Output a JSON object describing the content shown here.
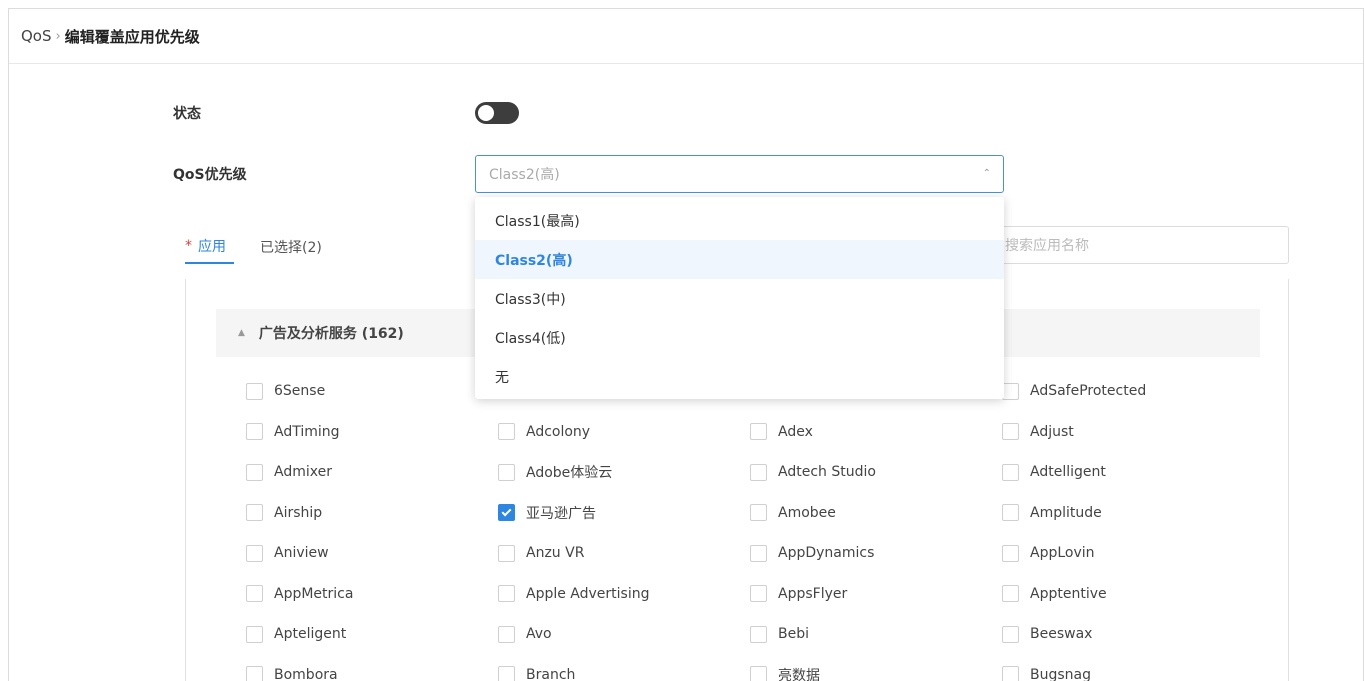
{
  "breadcrumb": {
    "root": "QoS",
    "separator": "›",
    "current": "编辑覆盖应用优先级"
  },
  "form": {
    "status_label": "状态",
    "status_enabled": false,
    "qos_label": "QoS优先级",
    "qos_value": "Class2(高)"
  },
  "dropdown": {
    "options": [
      "Class1(最高)",
      "Class2(高)",
      "Class3(中)",
      "Class4(低)",
      "无"
    ],
    "selected_index": 1
  },
  "tabs": {
    "required_mark": "*",
    "apps_label": "应用",
    "selected_label": "已选择(2)"
  },
  "search": {
    "placeholder": "搜索应用名称"
  },
  "category": {
    "name": "广告及分析服务 (162)"
  },
  "apps": [
    [
      {
        "name": "6Sense",
        "checked": false
      },
      {
        "name": "",
        "checked": false
      },
      {
        "name": "",
        "checked": false
      },
      {
        "name": "AdSafeProtected",
        "checked": false
      }
    ],
    [
      {
        "name": "AdTiming",
        "checked": false
      },
      {
        "name": "Adcolony",
        "checked": false
      },
      {
        "name": "Adex",
        "checked": false
      },
      {
        "name": "Adjust",
        "checked": false
      }
    ],
    [
      {
        "name": "Admixer",
        "checked": false
      },
      {
        "name": "Adobe体验云",
        "checked": false
      },
      {
        "name": "Adtech Studio",
        "checked": false
      },
      {
        "name": "Adtelligent",
        "checked": false
      }
    ],
    [
      {
        "name": "Airship",
        "checked": false
      },
      {
        "name": "亚马逊广告",
        "checked": true
      },
      {
        "name": "Amobee",
        "checked": false
      },
      {
        "name": "Amplitude",
        "checked": false
      }
    ],
    [
      {
        "name": "Aniview",
        "checked": false
      },
      {
        "name": "Anzu VR",
        "checked": false
      },
      {
        "name": "AppDynamics",
        "checked": false
      },
      {
        "name": "AppLovin",
        "checked": false
      }
    ],
    [
      {
        "name": "AppMetrica",
        "checked": false
      },
      {
        "name": "Apple Advertising",
        "checked": false
      },
      {
        "name": "AppsFlyer",
        "checked": false
      },
      {
        "name": "Apptentive",
        "checked": false
      }
    ],
    [
      {
        "name": "Apteligent",
        "checked": false
      },
      {
        "name": "Avo",
        "checked": false
      },
      {
        "name": "Bebi",
        "checked": false
      },
      {
        "name": "Beeswax",
        "checked": false
      }
    ],
    [
      {
        "name": "Bombora",
        "checked": false
      },
      {
        "name": "Branch",
        "checked": false
      },
      {
        "name": "亮数据",
        "checked": false
      },
      {
        "name": "Bugsnag",
        "checked": false
      }
    ]
  ],
  "colors": {
    "accent": "#2f86e0",
    "toggle_off": "#3d3d3d",
    "required": "#e04040"
  }
}
